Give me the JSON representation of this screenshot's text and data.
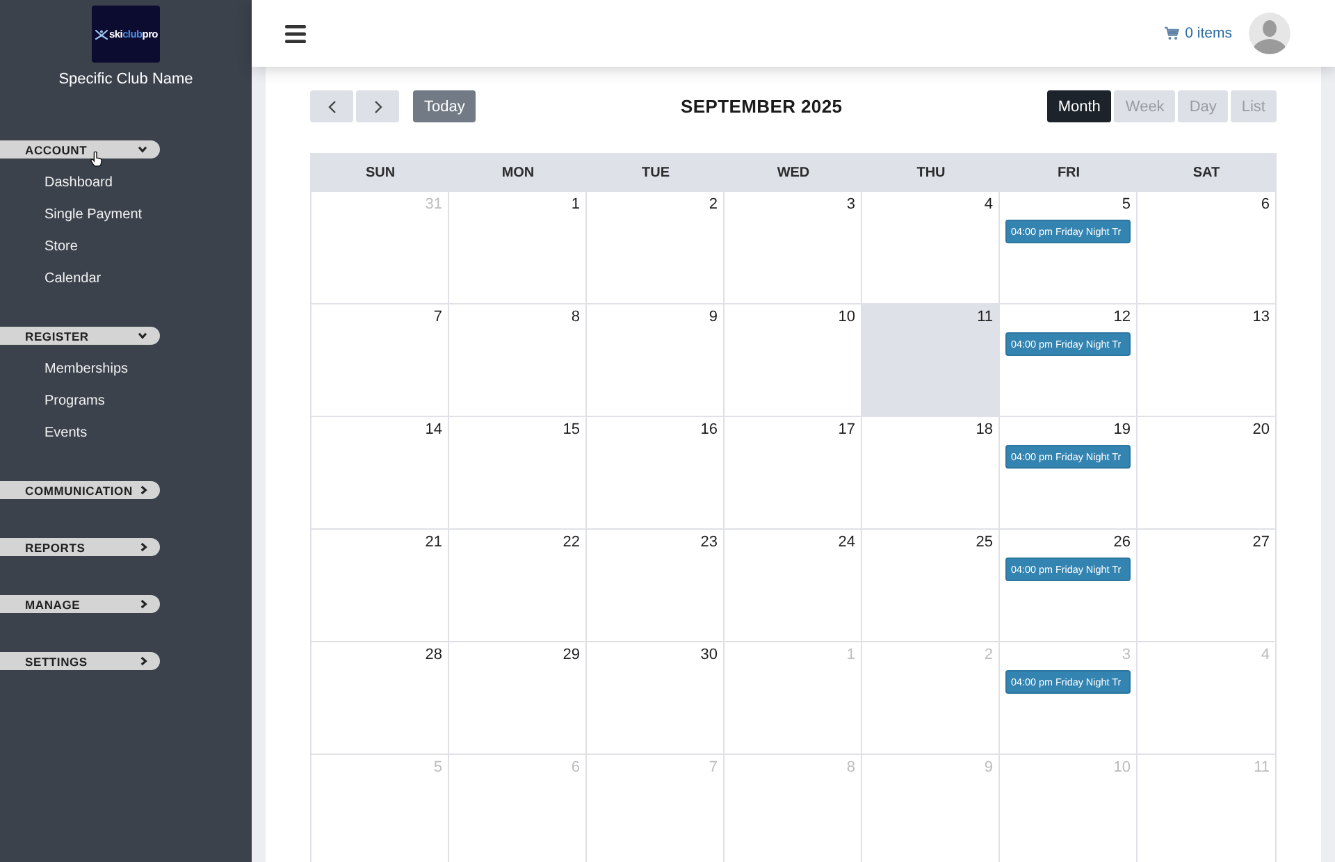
{
  "sidebar": {
    "logo": {
      "parts": [
        {
          "text": "ski",
          "color": "#ffffff"
        },
        {
          "text": "club",
          "color": "#4d8fe0"
        },
        {
          "text": "pro",
          "color": "#ffffff"
        }
      ]
    },
    "club_name": "Specific Club Name",
    "sections": [
      {
        "label": "ACCOUNT",
        "expanded": true,
        "items": [
          "Dashboard",
          "Single Payment",
          "Store",
          "Calendar"
        ]
      },
      {
        "label": "REGISTER",
        "expanded": true,
        "items": [
          "Memberships",
          "Programs",
          "Events"
        ]
      },
      {
        "label": "COMMUNICATION",
        "expanded": false
      },
      {
        "label": "REPORTS",
        "expanded": false
      },
      {
        "label": "MANAGE",
        "expanded": false
      },
      {
        "label": "SETTINGS",
        "expanded": false
      }
    ]
  },
  "topbar": {
    "cart": "0 items"
  },
  "calendar": {
    "today_button": "Today",
    "title": "SEPTEMBER 2025",
    "views": [
      {
        "label": "Month",
        "selected": true
      },
      {
        "label": "Week",
        "selected": false
      },
      {
        "label": "Day",
        "selected": false
      },
      {
        "label": "List",
        "selected": false
      }
    ],
    "weekdays": [
      "SUN",
      "MON",
      "TUE",
      "WED",
      "THU",
      "FRI",
      "SAT"
    ],
    "weeks": [
      [
        {
          "day": "31",
          "other_month": true,
          "today": false
        },
        {
          "day": "1",
          "other_month": false,
          "today": false
        },
        {
          "day": "2",
          "other_month": false,
          "today": false
        },
        {
          "day": "3",
          "other_month": false,
          "today": false
        },
        {
          "day": "4",
          "other_month": false,
          "today": false
        },
        {
          "day": "5",
          "other_month": false,
          "today": false,
          "events": [
            "04:00 pm Friday Night Tr"
          ]
        },
        {
          "day": "6",
          "other_month": false,
          "today": false
        }
      ],
      [
        {
          "day": "7",
          "other_month": false,
          "today": false
        },
        {
          "day": "8",
          "other_month": false,
          "today": false
        },
        {
          "day": "9",
          "other_month": false,
          "today": false
        },
        {
          "day": "10",
          "other_month": false,
          "today": false
        },
        {
          "day": "11",
          "other_month": false,
          "today": true
        },
        {
          "day": "12",
          "other_month": false,
          "today": false,
          "events": [
            "04:00 pm Friday Night Tr"
          ]
        },
        {
          "day": "13",
          "other_month": false,
          "today": false
        }
      ],
      [
        {
          "day": "14",
          "other_month": false,
          "today": false
        },
        {
          "day": "15",
          "other_month": false,
          "today": false
        },
        {
          "day": "16",
          "other_month": false,
          "today": false
        },
        {
          "day": "17",
          "other_month": false,
          "today": false
        },
        {
          "day": "18",
          "other_month": false,
          "today": false
        },
        {
          "day": "19",
          "other_month": false,
          "today": false,
          "events": [
            "04:00 pm Friday Night Tr"
          ]
        },
        {
          "day": "20",
          "other_month": false,
          "today": false
        }
      ],
      [
        {
          "day": "21",
          "other_month": false,
          "today": false
        },
        {
          "day": "22",
          "other_month": false,
          "today": false
        },
        {
          "day": "23",
          "other_month": false,
          "today": false
        },
        {
          "day": "24",
          "other_month": false,
          "today": false
        },
        {
          "day": "25",
          "other_month": false,
          "today": false
        },
        {
          "day": "26",
          "other_month": false,
          "today": false,
          "events": [
            "04:00 pm Friday Night Tr"
          ]
        },
        {
          "day": "27",
          "other_month": false,
          "today": false
        }
      ],
      [
        {
          "day": "28",
          "other_month": false,
          "today": false
        },
        {
          "day": "29",
          "other_month": false,
          "today": false
        },
        {
          "day": "30",
          "other_month": false,
          "today": false
        },
        {
          "day": "1",
          "other_month": true,
          "today": false
        },
        {
          "day": "2",
          "other_month": true,
          "today": false
        },
        {
          "day": "3",
          "other_month": true,
          "today": false,
          "events": [
            "04:00 pm Friday Night Tr"
          ]
        },
        {
          "day": "4",
          "other_month": true,
          "today": false
        }
      ],
      [
        {
          "day": "5",
          "other_month": true,
          "today": false
        },
        {
          "day": "6",
          "other_month": true,
          "today": false
        },
        {
          "day": "7",
          "other_month": true,
          "today": false
        },
        {
          "day": "8",
          "other_month": true,
          "today": false
        },
        {
          "day": "9",
          "other_month": true,
          "today": false
        },
        {
          "day": "10",
          "other_month": true,
          "today": false
        },
        {
          "day": "11",
          "other_month": true,
          "today": false
        }
      ]
    ]
  }
}
